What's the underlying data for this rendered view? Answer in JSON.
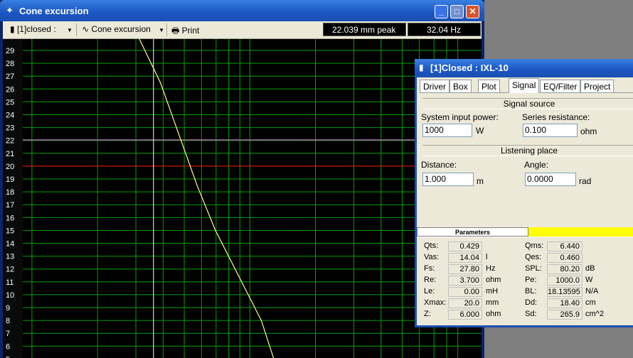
{
  "main_window": {
    "title": "Cone excursion",
    "toolbar": {
      "project_select": "[1]closed :",
      "plot_select": "Cone excursion",
      "print_label": "Print",
      "peak_readout": "22.039 mm peak",
      "freq_readout": "32.04 Hz"
    }
  },
  "chart_data": {
    "type": "line",
    "title": "",
    "xlabel": "",
    "ylabel": "",
    "ylim": [
      4,
      30
    ],
    "y_ticks": [
      "29",
      "28",
      "27",
      "26",
      "25",
      "24",
      "23",
      "22",
      "21",
      "20",
      "19",
      "18",
      "17",
      "16",
      "15",
      "14",
      "13",
      "12",
      "11",
      "10",
      "9",
      "8",
      "7",
      "6",
      "5"
    ],
    "grid": true,
    "series": [
      {
        "x": [
          0.25,
          0.3,
          0.345,
          0.38,
          0.42,
          0.47,
          0.52,
          0.55
        ],
        "y": [
          30.2,
          26.5,
          22.0,
          18.5,
          15.0,
          11.5,
          8.0,
          4.7
        ],
        "color": "#ffff7f"
      }
    ],
    "markers": {
      "limit_line": {
        "y": 20,
        "color": "#ff0000"
      },
      "cursor_line": {
        "y": 22.039,
        "color": "#ff80ff"
      },
      "cursor_x": 0.285,
      "cursor_x_color": "#ffffff"
    }
  },
  "param_window": {
    "title": "[1]Closed : IXL-10",
    "tabs": [
      "Driver",
      "Box",
      "Plot",
      "Signal",
      "EQ/Filter",
      "Project"
    ],
    "active_tab": "Signal",
    "signal_source": {
      "heading": "Signal source",
      "power_label": "System input power:",
      "power_value": "1000",
      "power_unit": "W",
      "resistance_label": "Series resistance:",
      "resistance_value": "0.100",
      "resistance_unit": "ohm"
    },
    "listening_place": {
      "heading": "Listening place",
      "distance_label": "Distance:",
      "distance_value": "1.000",
      "distance_unit": "m",
      "angle_label": "Angle:",
      "angle_value": "0.0000",
      "angle_unit": "rad"
    },
    "parameters_heading": "Parameters",
    "params_left": [
      {
        "label": "Qts:",
        "value": "0.429",
        "unit": ""
      },
      {
        "label": "Vas:",
        "value": "14.04",
        "unit": "l"
      },
      {
        "label": "Fs:",
        "value": "27.80",
        "unit": "Hz"
      },
      {
        "label": "Re:",
        "value": "3.700",
        "unit": "ohm"
      },
      {
        "label": "Le:",
        "value": "0.00",
        "unit": "mH"
      },
      {
        "label": "Xmax:",
        "value": "20.0",
        "unit": "mm"
      },
      {
        "label": "Z:",
        "value": "6.000",
        "unit": "ohm"
      }
    ],
    "params_right": [
      {
        "label": "Qms:",
        "value": "6.440",
        "unit": ""
      },
      {
        "label": "Qes:",
        "value": "0.460",
        "unit": ""
      },
      {
        "label": "SPL:",
        "value": "80.20",
        "unit": "dB"
      },
      {
        "label": "Pe:",
        "value": "1000.0",
        "unit": "W"
      },
      {
        "label": "BL:",
        "value": "18.13595",
        "unit": "N/A"
      },
      {
        "label": "Dd:",
        "value": "18.40",
        "unit": "cm"
      },
      {
        "label": "Sd:",
        "value": "265.9",
        "unit": "cm^2"
      }
    ]
  }
}
